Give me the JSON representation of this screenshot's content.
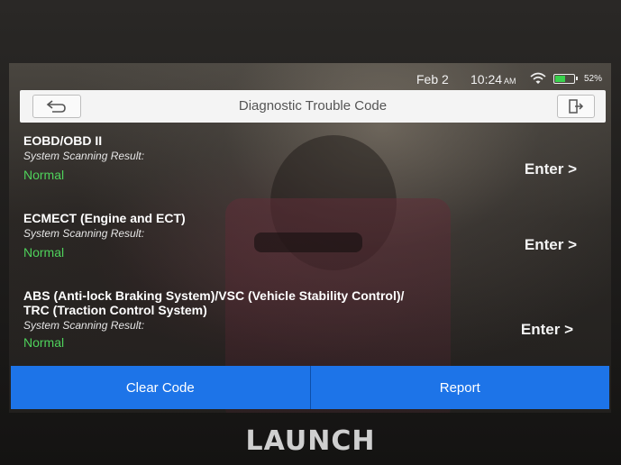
{
  "status_bar": {
    "date": "Feb 2",
    "time": "10:24",
    "ampm": "AM",
    "battery": "52%",
    "battery_level": 0.52
  },
  "header": {
    "title": "Diagnostic Trouble Code"
  },
  "systems": [
    {
      "name": "EOBD/OBD II",
      "result_label": "System Scanning Result:",
      "result": "Normal",
      "action": "Enter >"
    },
    {
      "name": "ECMECT (Engine and ECT)",
      "result_label": "System Scanning Result:",
      "result": "Normal",
      "action": "Enter >"
    },
    {
      "name_line1": "ABS (Anti-lock Braking System)/VSC (Vehicle Stability Control)/",
      "name_line2": "TRC (Traction Control System)",
      "result_label": "System Scanning Result:",
      "result": "Normal",
      "action": "Enter >"
    }
  ],
  "footer": {
    "clear_label": "Clear Code",
    "report_label": "Report"
  },
  "device": {
    "brand": "LAUNCH"
  },
  "colors": {
    "accent": "#1d74e8",
    "normal": "#4fd25b"
  }
}
